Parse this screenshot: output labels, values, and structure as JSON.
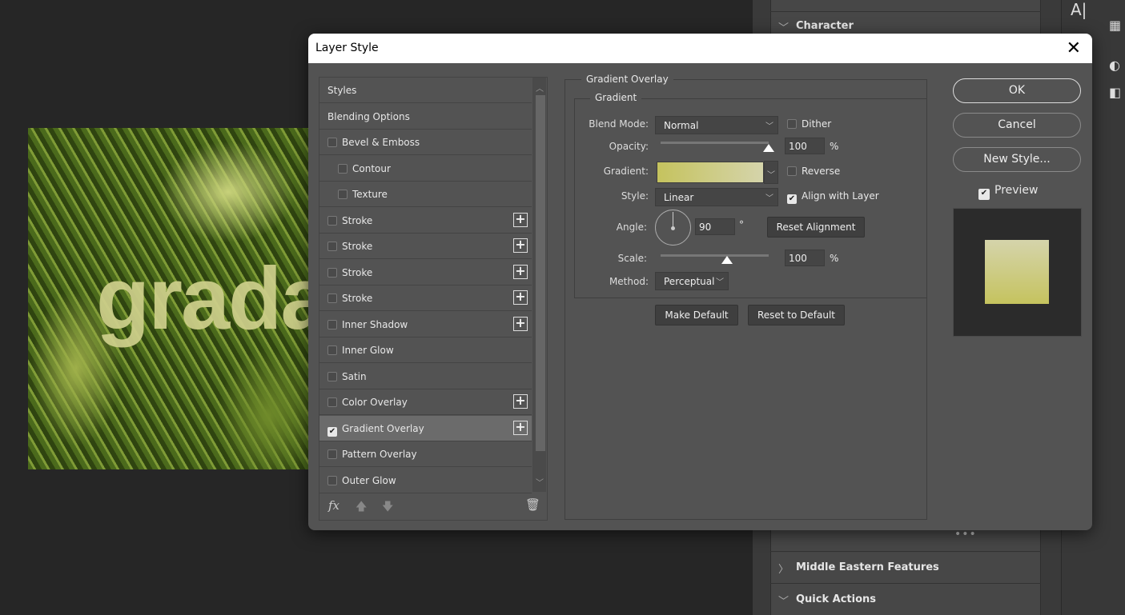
{
  "canvas": {
    "text": "grada"
  },
  "right_panel": {
    "sections": [
      {
        "label": "Character",
        "expanded": true
      },
      {
        "label": "Middle Eastern Features",
        "expanded": false
      },
      {
        "label": "Quick Actions",
        "expanded": true
      }
    ]
  },
  "dialog": {
    "title": "Layer Style",
    "styles_list": [
      {
        "label": "Styles",
        "checkbox": false
      },
      {
        "label": "Blending Options",
        "checkbox": false
      },
      {
        "label": "Bevel & Emboss",
        "checkbox": true,
        "checked": false
      },
      {
        "label": "Contour",
        "checkbox": true,
        "checked": false,
        "indent": true
      },
      {
        "label": "Texture",
        "checkbox": true,
        "checked": false,
        "indent": true
      },
      {
        "label": "Stroke",
        "checkbox": true,
        "checked": false,
        "plus": true
      },
      {
        "label": "Stroke",
        "checkbox": true,
        "checked": false,
        "plus": true
      },
      {
        "label": "Stroke",
        "checkbox": true,
        "checked": false,
        "plus": true
      },
      {
        "label": "Stroke",
        "checkbox": true,
        "checked": false,
        "plus": true
      },
      {
        "label": "Inner Shadow",
        "checkbox": true,
        "checked": false,
        "plus": true
      },
      {
        "label": "Inner Glow",
        "checkbox": true,
        "checked": false
      },
      {
        "label": "Satin",
        "checkbox": true,
        "checked": false
      },
      {
        "label": "Color Overlay",
        "checkbox": true,
        "checked": false,
        "plus": true
      },
      {
        "label": "Gradient Overlay",
        "checkbox": true,
        "checked": true,
        "plus": true,
        "selected": true
      },
      {
        "label": "Pattern Overlay",
        "checkbox": true,
        "checked": false
      },
      {
        "label": "Outer Glow",
        "checkbox": true,
        "checked": false
      }
    ],
    "footer": {
      "fx_label": "fx"
    },
    "panel": {
      "title": "Gradient Overlay",
      "group_title": "Gradient",
      "blend_mode": {
        "label": "Blend Mode:",
        "value": "Normal"
      },
      "dither": {
        "label": "Dither",
        "checked": false
      },
      "opacity": {
        "label": "Opacity:",
        "value": "100",
        "unit": "%",
        "level": 100
      },
      "gradient": {
        "label": "Gradient:",
        "from": "#c5c35e",
        "to": "#d5d4ab"
      },
      "reverse": {
        "label": "Reverse",
        "checked": false
      },
      "style": {
        "label": "Style:",
        "value": "Linear"
      },
      "align": {
        "label": "Align with Layer",
        "checked": true
      },
      "angle": {
        "label": "Angle:",
        "value": "90",
        "unit": "°"
      },
      "reset_alignment": "Reset Alignment",
      "scale": {
        "label": "Scale:",
        "value": "100",
        "unit": "%",
        "level": 100
      },
      "method": {
        "label": "Method:",
        "value": "Perceptual"
      },
      "make_default": "Make Default",
      "reset_default": "Reset to Default"
    },
    "buttons": {
      "ok": "OK",
      "cancel": "Cancel",
      "new_style": "New Style..."
    },
    "preview": {
      "label": "Preview",
      "checked": true
    }
  }
}
